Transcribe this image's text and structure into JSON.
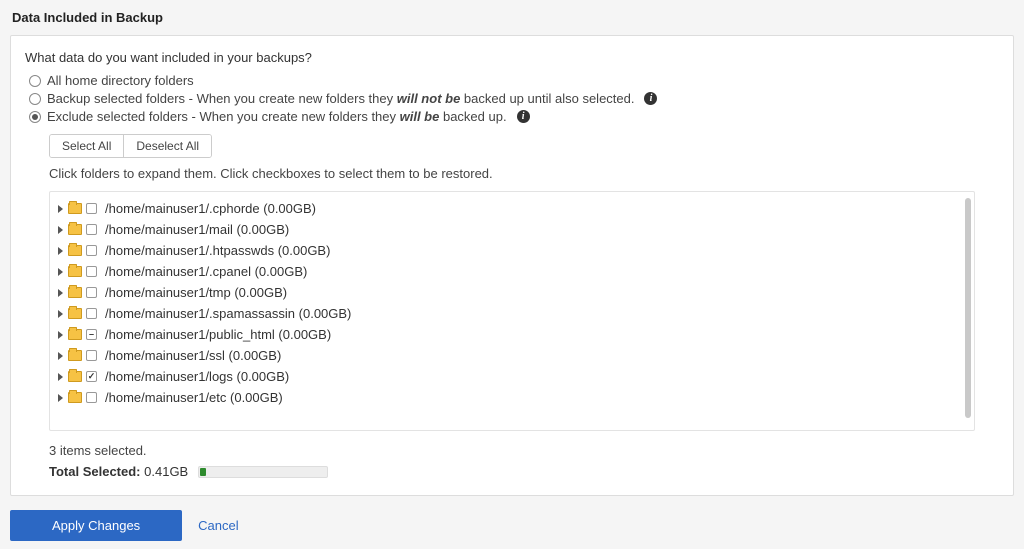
{
  "title": "Data Included in Backup",
  "question": "What data do you want included in your backups?",
  "options": {
    "opt1": {
      "label": "All home directory folders",
      "checked": false
    },
    "opt2": {
      "prefix": "Backup selected folders - When you create new folders they ",
      "em": "will not be",
      "suffix": " backed up until also selected.",
      "checked": false
    },
    "opt3": {
      "prefix": "Exclude selected folders - When you create new folders they ",
      "em": "will be",
      "suffix": " backed up.",
      "checked": true
    }
  },
  "buttons": {
    "select_all": "Select All",
    "deselect_all": "Deselect All"
  },
  "hint": "Click folders to expand them. Click checkboxes to select them to be restored.",
  "folders": [
    {
      "path": "/home/mainuser1/.cphorde (0.00GB)",
      "state": "none"
    },
    {
      "path": "/home/mainuser1/mail (0.00GB)",
      "state": "none"
    },
    {
      "path": "/home/mainuser1/.htpasswds (0.00GB)",
      "state": "none"
    },
    {
      "path": "/home/mainuser1/.cpanel (0.00GB)",
      "state": "none"
    },
    {
      "path": "/home/mainuser1/tmp (0.00GB)",
      "state": "none"
    },
    {
      "path": "/home/mainuser1/.spamassassin (0.00GB)",
      "state": "none"
    },
    {
      "path": "/home/mainuser1/public_html (0.00GB)",
      "state": "minus"
    },
    {
      "path": "/home/mainuser1/ssl (0.00GB)",
      "state": "none"
    },
    {
      "path": "/home/mainuser1/logs (0.00GB)",
      "state": "checked"
    },
    {
      "path": "/home/mainuser1/etc (0.00GB)",
      "state": "none"
    }
  ],
  "status": "3 items selected.",
  "total": {
    "label": "Total Selected:",
    "value": "0.41GB"
  },
  "footer": {
    "apply": "Apply Changes",
    "cancel": "Cancel"
  }
}
